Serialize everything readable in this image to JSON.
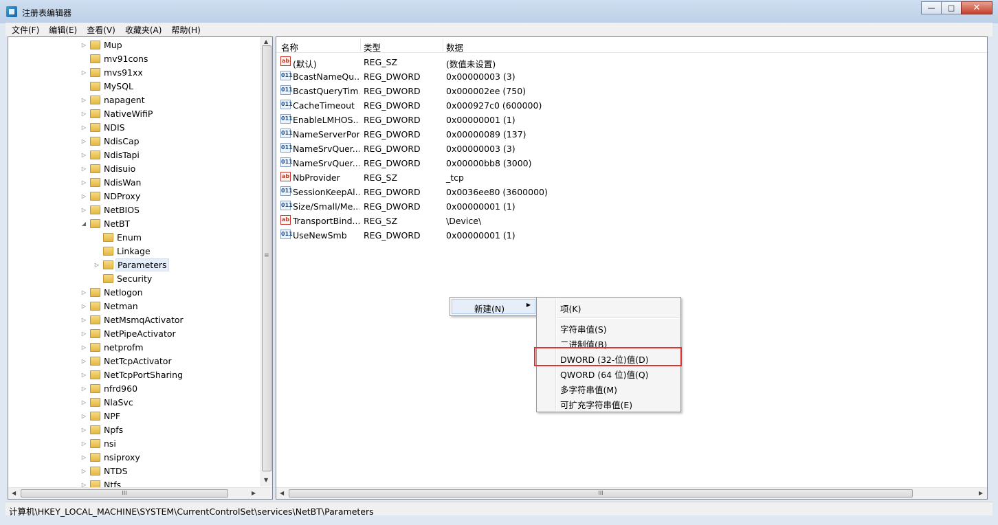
{
  "window": {
    "title": "注册表编辑器",
    "min": "—",
    "max": "□",
    "close": "✕"
  },
  "menu": [
    "文件(F)",
    "编辑(E)",
    "查看(V)",
    "收藏夹(A)",
    "帮助(H)"
  ],
  "tree": [
    {
      "label": "Mup",
      "level": 1,
      "expander": "▷"
    },
    {
      "label": "mv91cons",
      "level": 1,
      "expander": ""
    },
    {
      "label": "mvs91xx",
      "level": 1,
      "expander": "▷"
    },
    {
      "label": "MySQL",
      "level": 1,
      "expander": ""
    },
    {
      "label": "napagent",
      "level": 1,
      "expander": "▷"
    },
    {
      "label": "NativeWifiP",
      "level": 1,
      "expander": "▷"
    },
    {
      "label": "NDIS",
      "level": 1,
      "expander": "▷"
    },
    {
      "label": "NdisCap",
      "level": 1,
      "expander": "▷"
    },
    {
      "label": "NdisTapi",
      "level": 1,
      "expander": "▷"
    },
    {
      "label": "Ndisuio",
      "level": 1,
      "expander": "▷"
    },
    {
      "label": "NdisWan",
      "level": 1,
      "expander": "▷"
    },
    {
      "label": "NDProxy",
      "level": 1,
      "expander": "▷"
    },
    {
      "label": "NetBIOS",
      "level": 1,
      "expander": "▷"
    },
    {
      "label": "NetBT",
      "level": 1,
      "expander": "◢"
    },
    {
      "label": "Enum",
      "level": 2,
      "expander": ""
    },
    {
      "label": "Linkage",
      "level": 2,
      "expander": ""
    },
    {
      "label": "Parameters",
      "level": 2,
      "expander": "▷",
      "selected": true
    },
    {
      "label": "Security",
      "level": 2,
      "expander": ""
    },
    {
      "label": "Netlogon",
      "level": 1,
      "expander": "▷"
    },
    {
      "label": "Netman",
      "level": 1,
      "expander": "▷"
    },
    {
      "label": "NetMsmqActivator",
      "level": 1,
      "expander": "▷"
    },
    {
      "label": "NetPipeActivator",
      "level": 1,
      "expander": "▷"
    },
    {
      "label": "netprofm",
      "level": 1,
      "expander": "▷"
    },
    {
      "label": "NetTcpActivator",
      "level": 1,
      "expander": "▷"
    },
    {
      "label": "NetTcpPortSharing",
      "level": 1,
      "expander": "▷"
    },
    {
      "label": "nfrd960",
      "level": 1,
      "expander": "▷"
    },
    {
      "label": "NlaSvc",
      "level": 1,
      "expander": "▷"
    },
    {
      "label": "NPF",
      "level": 1,
      "expander": "▷"
    },
    {
      "label": "Npfs",
      "level": 1,
      "expander": "▷"
    },
    {
      "label": "nsi",
      "level": 1,
      "expander": "▷"
    },
    {
      "label": "nsiproxy",
      "level": 1,
      "expander": "▷"
    },
    {
      "label": "NTDS",
      "level": 1,
      "expander": "▷"
    },
    {
      "label": "Ntfs",
      "level": 1,
      "expander": "▷"
    }
  ],
  "list": {
    "headers": {
      "name": "名称",
      "type": "类型",
      "data": "数据"
    },
    "rows": [
      {
        "icon": "string",
        "glyph": "ab",
        "name": "(默认)",
        "type": "REG_SZ",
        "data": "(数值未设置)"
      },
      {
        "icon": "binary",
        "glyph": "011",
        "name": "BcastNameQu...",
        "type": "REG_DWORD",
        "data": "0x00000003 (3)"
      },
      {
        "icon": "binary",
        "glyph": "011",
        "name": "BcastQueryTim...",
        "type": "REG_DWORD",
        "data": "0x000002ee (750)"
      },
      {
        "icon": "binary",
        "glyph": "011",
        "name": "CacheTimeout",
        "type": "REG_DWORD",
        "data": "0x000927c0 (600000)"
      },
      {
        "icon": "binary",
        "glyph": "011",
        "name": "EnableLMHOS...",
        "type": "REG_DWORD",
        "data": "0x00000001 (1)"
      },
      {
        "icon": "binary",
        "glyph": "011",
        "name": "NameServerPort",
        "type": "REG_DWORD",
        "data": "0x00000089 (137)"
      },
      {
        "icon": "binary",
        "glyph": "011",
        "name": "NameSrvQuer...",
        "type": "REG_DWORD",
        "data": "0x00000003 (3)"
      },
      {
        "icon": "binary",
        "glyph": "011",
        "name": "NameSrvQuer...",
        "type": "REG_DWORD",
        "data": "0x00000bb8 (3000)"
      },
      {
        "icon": "string",
        "glyph": "ab",
        "name": "NbProvider",
        "type": "REG_SZ",
        "data": "_tcp"
      },
      {
        "icon": "binary",
        "glyph": "011",
        "name": "SessionKeepAl...",
        "type": "REG_DWORD",
        "data": "0x0036ee80 (3600000)"
      },
      {
        "icon": "binary",
        "glyph": "011",
        "name": "Size/Small/Me...",
        "type": "REG_DWORD",
        "data": "0x00000001 (1)"
      },
      {
        "icon": "string",
        "glyph": "ab",
        "name": "TransportBind...",
        "type": "REG_SZ",
        "data": "\\Device\\"
      },
      {
        "icon": "binary",
        "glyph": "011",
        "name": "UseNewSmb",
        "type": "REG_DWORD",
        "data": "0x00000001 (1)"
      }
    ]
  },
  "context_menu": {
    "new_label": "新建(N)",
    "new_arrow": "▶",
    "submenu": [
      "项(K)",
      "字符串值(S)",
      "二进制值(B)",
      "DWORD (32-位)值(D)",
      "QWORD (64 位)值(Q)",
      "多字符串值(M)",
      "可扩充字符串值(E)"
    ],
    "highlighted": "DWORD (32-位)值(D)"
  },
  "scroll": {
    "up": "▲",
    "down": "▼",
    "left": "◀",
    "right": "▶",
    "grip": "III",
    "vgrip": "≡"
  },
  "status": {
    "path": "计算机\\HKEY_LOCAL_MACHINE\\SYSTEM\\CurrentControlSet\\services\\NetBT\\Parameters"
  },
  "colors": {
    "highlight_border": "#e03030",
    "titlebar": "#c5d7ee",
    "selection": "#e5eef8"
  }
}
